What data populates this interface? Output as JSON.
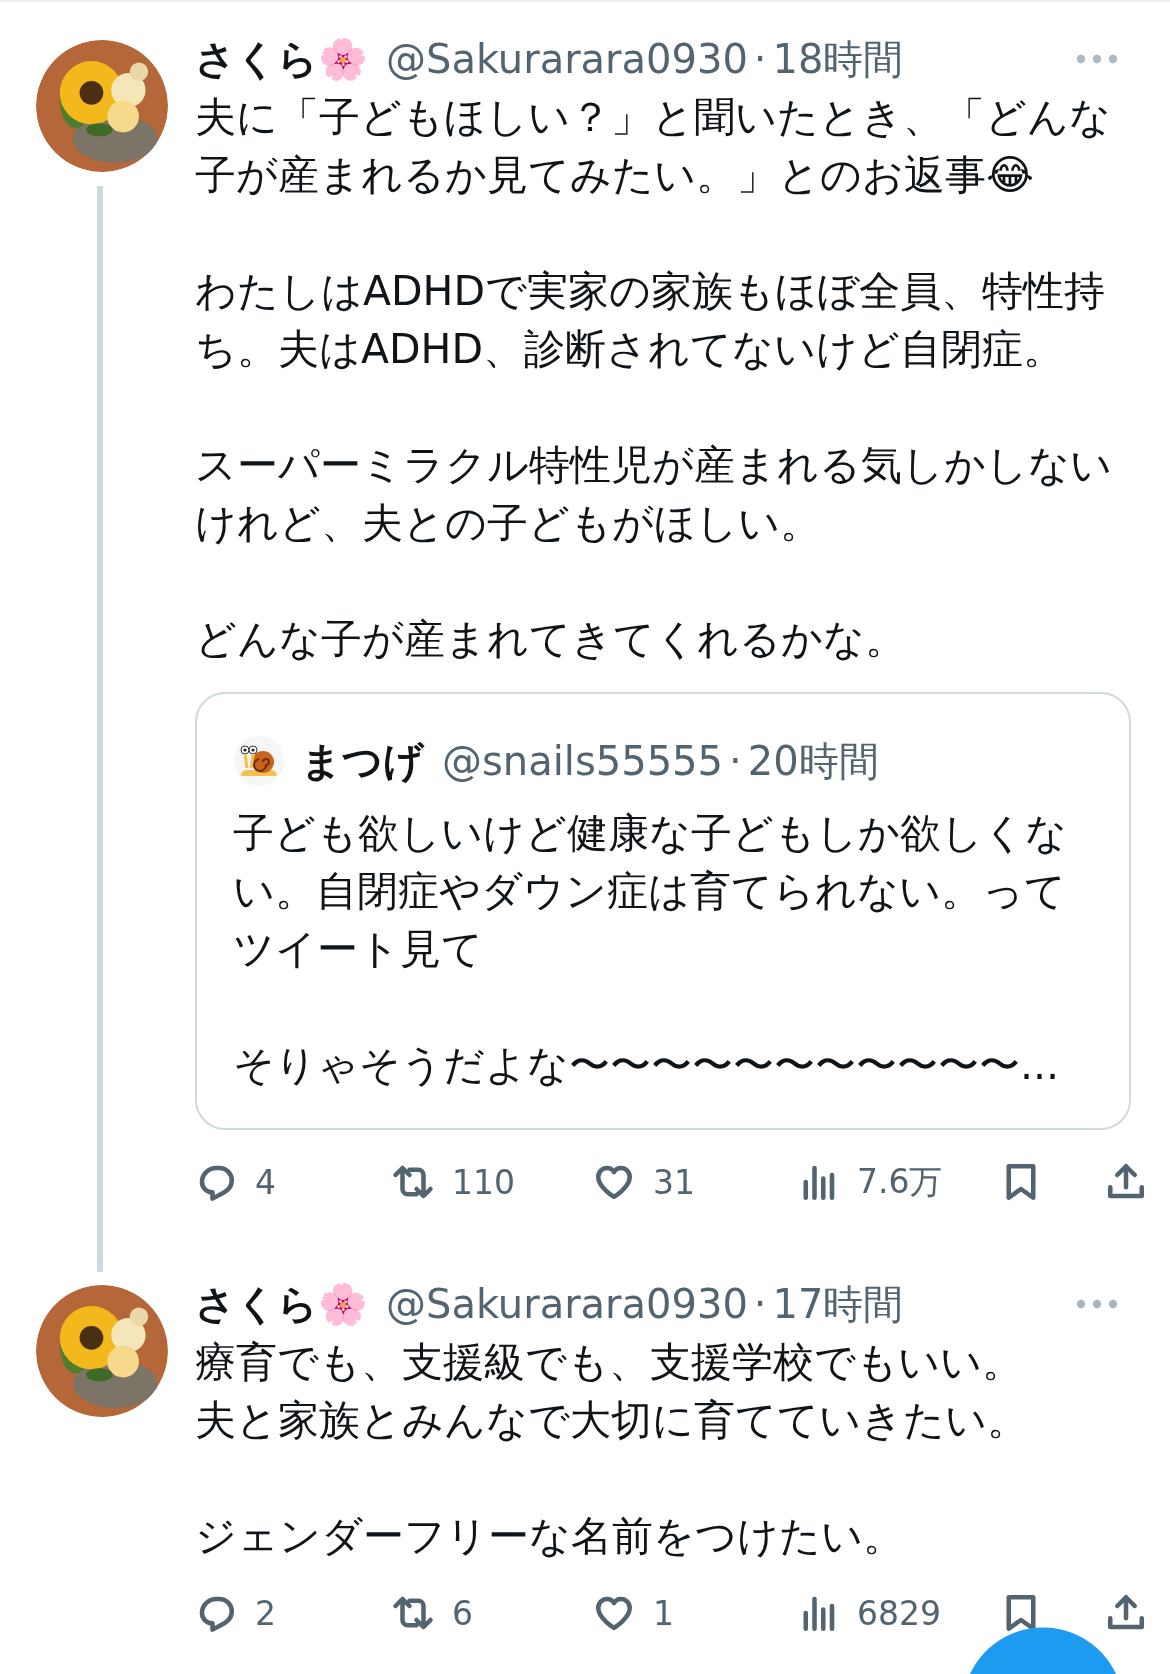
{
  "tweets": [
    {
      "name": "さくら🌸",
      "handle": "@Sakurarara0930",
      "separator": "·",
      "time": "18時間",
      "thread_line": true,
      "body": [
        "夫に「子どもほしい？」と聞いたとき、「どんな子が産まれるか見てみたい。」とのお返事😂",
        "わたしはADHDで実家の家族もほぼ全員、特性持ち。夫はADHD、診断されてないけど自閉症。",
        "スーパーミラクル特性児が産まれる気しかしないけれど、夫との子どもがほしい。",
        "どんな子が産まれてきてくれるかな。"
      ],
      "quote": {
        "name": "まつげ",
        "handle": "@snails55555",
        "separator": "·",
        "time": "20時間",
        "body": [
          "子ども欲しいけど健康な子どもしか欲しくない。自閉症やダウン症は育てられない。ってツイート見て",
          "そりゃそうだよな〜〜〜〜〜〜〜〜〜〜〜..."
        ]
      },
      "actions": [
        {
          "kind": "reply",
          "count": "4"
        },
        {
          "kind": "retweet",
          "count": "110"
        },
        {
          "kind": "like",
          "count": "31"
        },
        {
          "kind": "views",
          "count": "7.6万"
        },
        {
          "kind": "bookmark"
        },
        {
          "kind": "share"
        }
      ]
    },
    {
      "name": "さくら🌸",
      "handle": "@Sakurarara0930",
      "separator": "·",
      "time": "17時間",
      "thread_line": false,
      "body": [
        [
          "療育でも、支援級でも、支援学校でもいい。",
          "夫と家族とみんなで大切に育てていきたい。"
        ],
        "ジェンダーフリーな名前をつけたい。"
      ],
      "actions": [
        {
          "kind": "reply",
          "count": "2"
        },
        {
          "kind": "retweet",
          "count": "6"
        },
        {
          "kind": "like",
          "count": "1"
        },
        {
          "kind": "views",
          "count": "6829"
        },
        {
          "kind": "bookmark"
        },
        {
          "kind": "share"
        }
      ]
    }
  ],
  "compose_button": {
    "kind": "fab"
  }
}
